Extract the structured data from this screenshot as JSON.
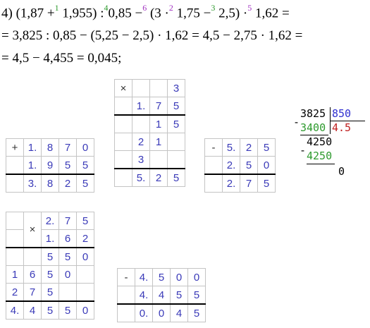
{
  "equations": {
    "line1": {
      "prefix": "4)",
      "open1": "(1,87 +",
      "s1": "1",
      "part1b": "1,955)",
      "div_op": ":",
      "s4": "4",
      "part2": "0,85 −",
      "s6": "6",
      "part3": "(3 ·",
      "s2": "2",
      "part4": "1,75 −",
      "s3": "3",
      "part5": "2,5)",
      "mul_op": "·",
      "s5": "5",
      "part6": "1,62 ="
    },
    "line2": "= 3,825 : 0,85 − (5,25 − 2,5) · 1,62 = 4,5 − 2,75 · 1,62 =",
    "line3": "= 4,5 − 4,455 = 0,045;"
  },
  "grids": {
    "addition": {
      "op": "+",
      "rows": [
        [
          "1.",
          "8",
          "7",
          "0"
        ],
        [
          "1.",
          "9",
          "5",
          "5"
        ],
        [
          "3.",
          "8",
          "2",
          "5"
        ]
      ]
    },
    "mult1": {
      "op": "×",
      "rows": [
        [
          "",
          "",
          "",
          "3"
        ],
        [
          "",
          "1.",
          "7",
          "5"
        ],
        [
          "",
          "",
          "1",
          "5"
        ],
        [
          "",
          "2",
          "1",
          ""
        ],
        [
          "",
          "3",
          "",
          ""
        ],
        [
          "",
          "5.",
          "2",
          "5"
        ]
      ]
    },
    "sub1": {
      "op": "-",
      "rows": [
        [
          "5.",
          "2",
          "5"
        ],
        [
          "2.",
          "5",
          "0"
        ],
        [
          "2.",
          "7",
          "5"
        ]
      ]
    },
    "mult2": {
      "op": "×",
      "rows": [
        [
          "",
          "",
          "2.",
          "7",
          "5"
        ],
        [
          "",
          "",
          "1.",
          "6",
          "2"
        ],
        [
          "",
          "",
          "5",
          "5",
          "0"
        ],
        [
          "1",
          "6",
          "5",
          "0",
          ""
        ],
        [
          "2",
          "7",
          "5",
          "",
          ""
        ],
        [
          "4.",
          "4",
          "5",
          "5",
          "0"
        ]
      ]
    },
    "sub2": {
      "op": "-",
      "rows": [
        [
          "4.",
          "5",
          "0",
          "0"
        ],
        [
          "4.",
          "4",
          "5",
          "5"
        ],
        [
          "0.",
          "0",
          "4",
          "5"
        ]
      ]
    }
  },
  "long_division": {
    "dividend": "3825",
    "divisor": "850",
    "sub1": "3400",
    "quotient": "4.5",
    "remainder1": "4250",
    "sub2": "4250",
    "remainder2": "0",
    "minus1": "-",
    "minus2": "-"
  },
  "colors": {
    "digits": "#3a3ab8",
    "superscript_green": "#2e9a2e",
    "superscript_blue": "#3030d0",
    "superscript_purple": "#a030c0",
    "quotient_red": "#c02020"
  }
}
